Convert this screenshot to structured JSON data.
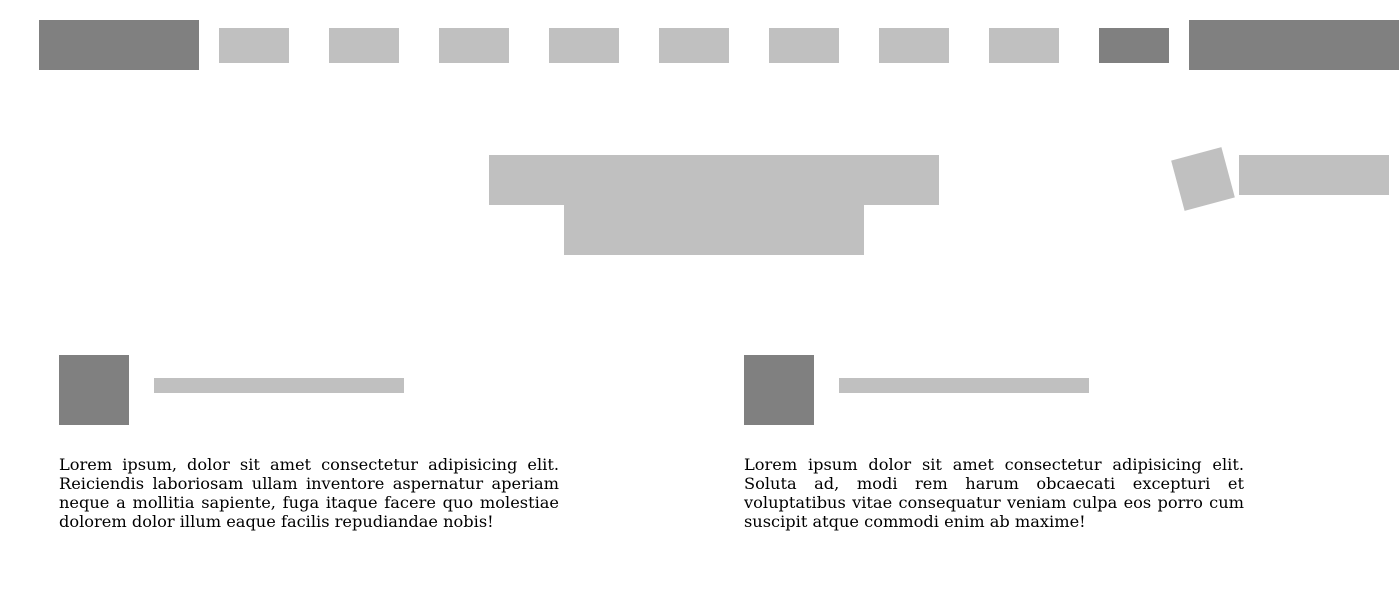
{
  "header": {
    "nav_items": [
      {
        "state": "default"
      },
      {
        "state": "default"
      },
      {
        "state": "default"
      },
      {
        "state": "default"
      },
      {
        "state": "default"
      },
      {
        "state": "default"
      },
      {
        "state": "default"
      },
      {
        "state": "default"
      },
      {
        "state": "active"
      }
    ]
  },
  "features": [
    {
      "text": "Lorem ipsum, dolor sit amet consectetur adipisicing elit. Reiciendis laboriosam ullam inventore aspernatur aperiam neque a mollitia sapiente, fuga itaque facere quo molestiae dolorem dolor illum eaque facilis repudiandae nobis!"
    },
    {
      "text": "Lorem ipsum dolor sit amet consectetur adipisicing elit. Soluta ad, modi rem harum obcaecati excepturi et voluptatibus vitae consequatur veniam culpa eos porro cum suscipit atque commodi enim ab maxime!"
    }
  ],
  "colors": {
    "dark_placeholder": "#808080",
    "light_placeholder": "#c0c0c0",
    "background": "#ffffff",
    "text": "#000000"
  }
}
